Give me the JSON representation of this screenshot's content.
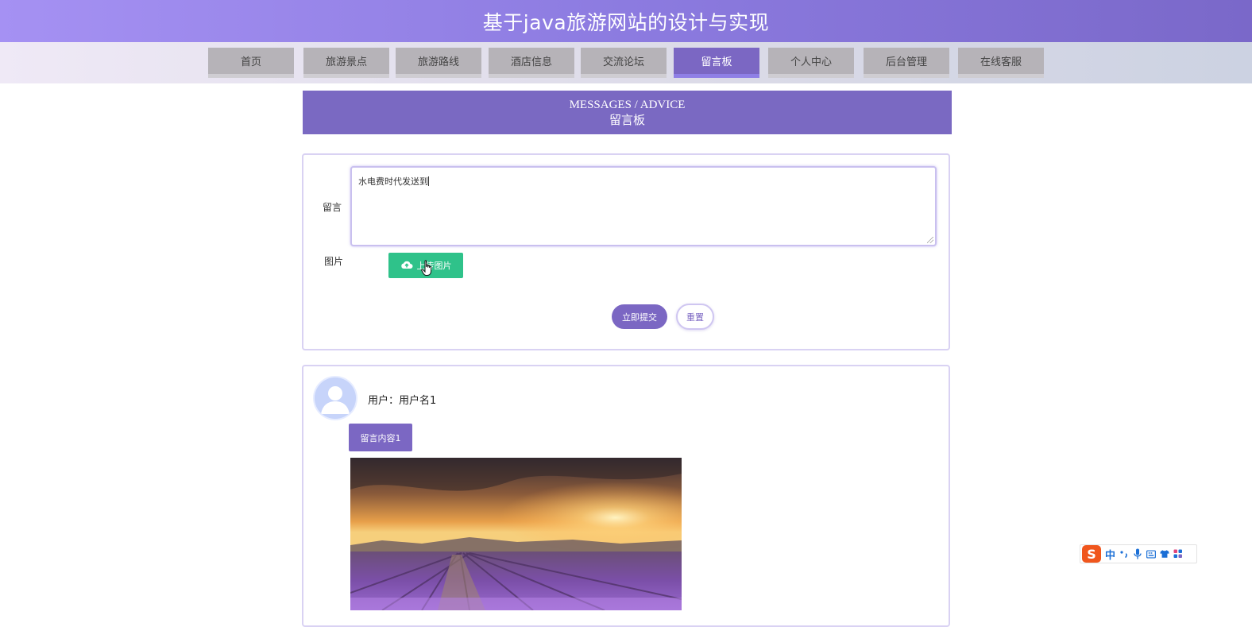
{
  "header": {
    "title": "基于java旅游网站的设计与实现"
  },
  "nav": {
    "items": [
      {
        "label": "首页"
      },
      {
        "label": "旅游景点"
      },
      {
        "label": "旅游路线"
      },
      {
        "label": "酒店信息"
      },
      {
        "label": "交流论坛"
      },
      {
        "label": "留言板",
        "active": true
      },
      {
        "label": "个人中心"
      },
      {
        "label": "后台管理"
      },
      {
        "label": "在线客服"
      }
    ]
  },
  "section": {
    "title_en": "MESSAGES / ADVICE",
    "title_cn": "留言板"
  },
  "form": {
    "message_label": "留言",
    "message_value": "水电费时代发送到",
    "image_label": "图片",
    "upload_label": "上传图片",
    "submit_label": "立即提交",
    "reset_label": "重置"
  },
  "messages": [
    {
      "user_label": "用户：用户名1",
      "content": "留言内容1"
    }
  ],
  "ime": {
    "logo": "S",
    "lang": "中"
  },
  "colors": {
    "accent": "#7b67c3",
    "header_gradient_start": "#a591f3",
    "header_gradient_end": "#7a68c9",
    "upload_green": "#2fc28a"
  }
}
